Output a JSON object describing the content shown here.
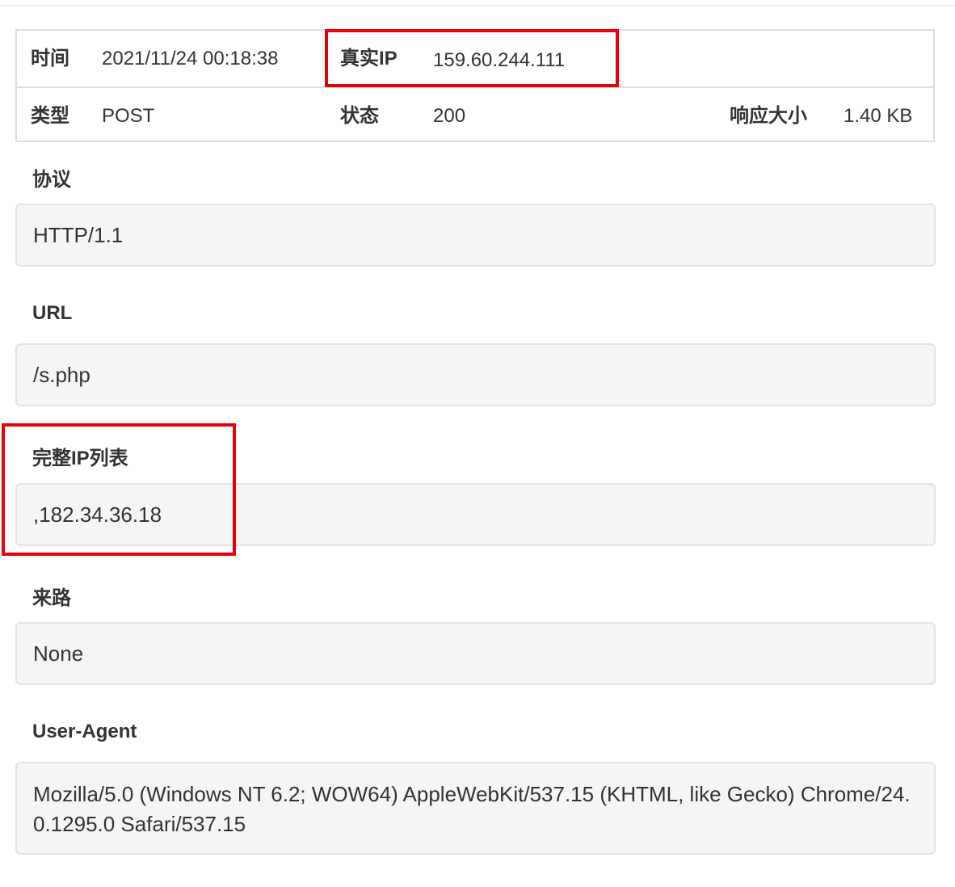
{
  "info_table": {
    "time_label": "时间",
    "time_value": "2021/11/24 00:18:38",
    "real_ip_label": "真实IP",
    "real_ip_value": "159.60.244.111",
    "type_label": "类型",
    "type_value": "POST",
    "status_label": "状态",
    "status_value": "200",
    "size_label": "响应大小",
    "size_value": "1.40 KB"
  },
  "protocol": {
    "label": "协议",
    "value": "HTTP/1.1"
  },
  "url": {
    "label": "URL",
    "value": "/s.php"
  },
  "ip_list": {
    "label": "完整IP列表",
    "value": ",182.34.36.18"
  },
  "referer": {
    "label": "来路",
    "value": "None"
  },
  "user_agent": {
    "label": "User-Agent",
    "value": "Mozilla/5.0 (Windows NT 6.2; WOW64) AppleWebKit/537.15 (KHTML, like Gecko) Chrome/24.0.1295.0 Safari/537.15"
  },
  "colors": {
    "highlight": "#e8000b",
    "well_bg": "#f5f5f5",
    "border": "#dddddd",
    "text": "#333333"
  }
}
